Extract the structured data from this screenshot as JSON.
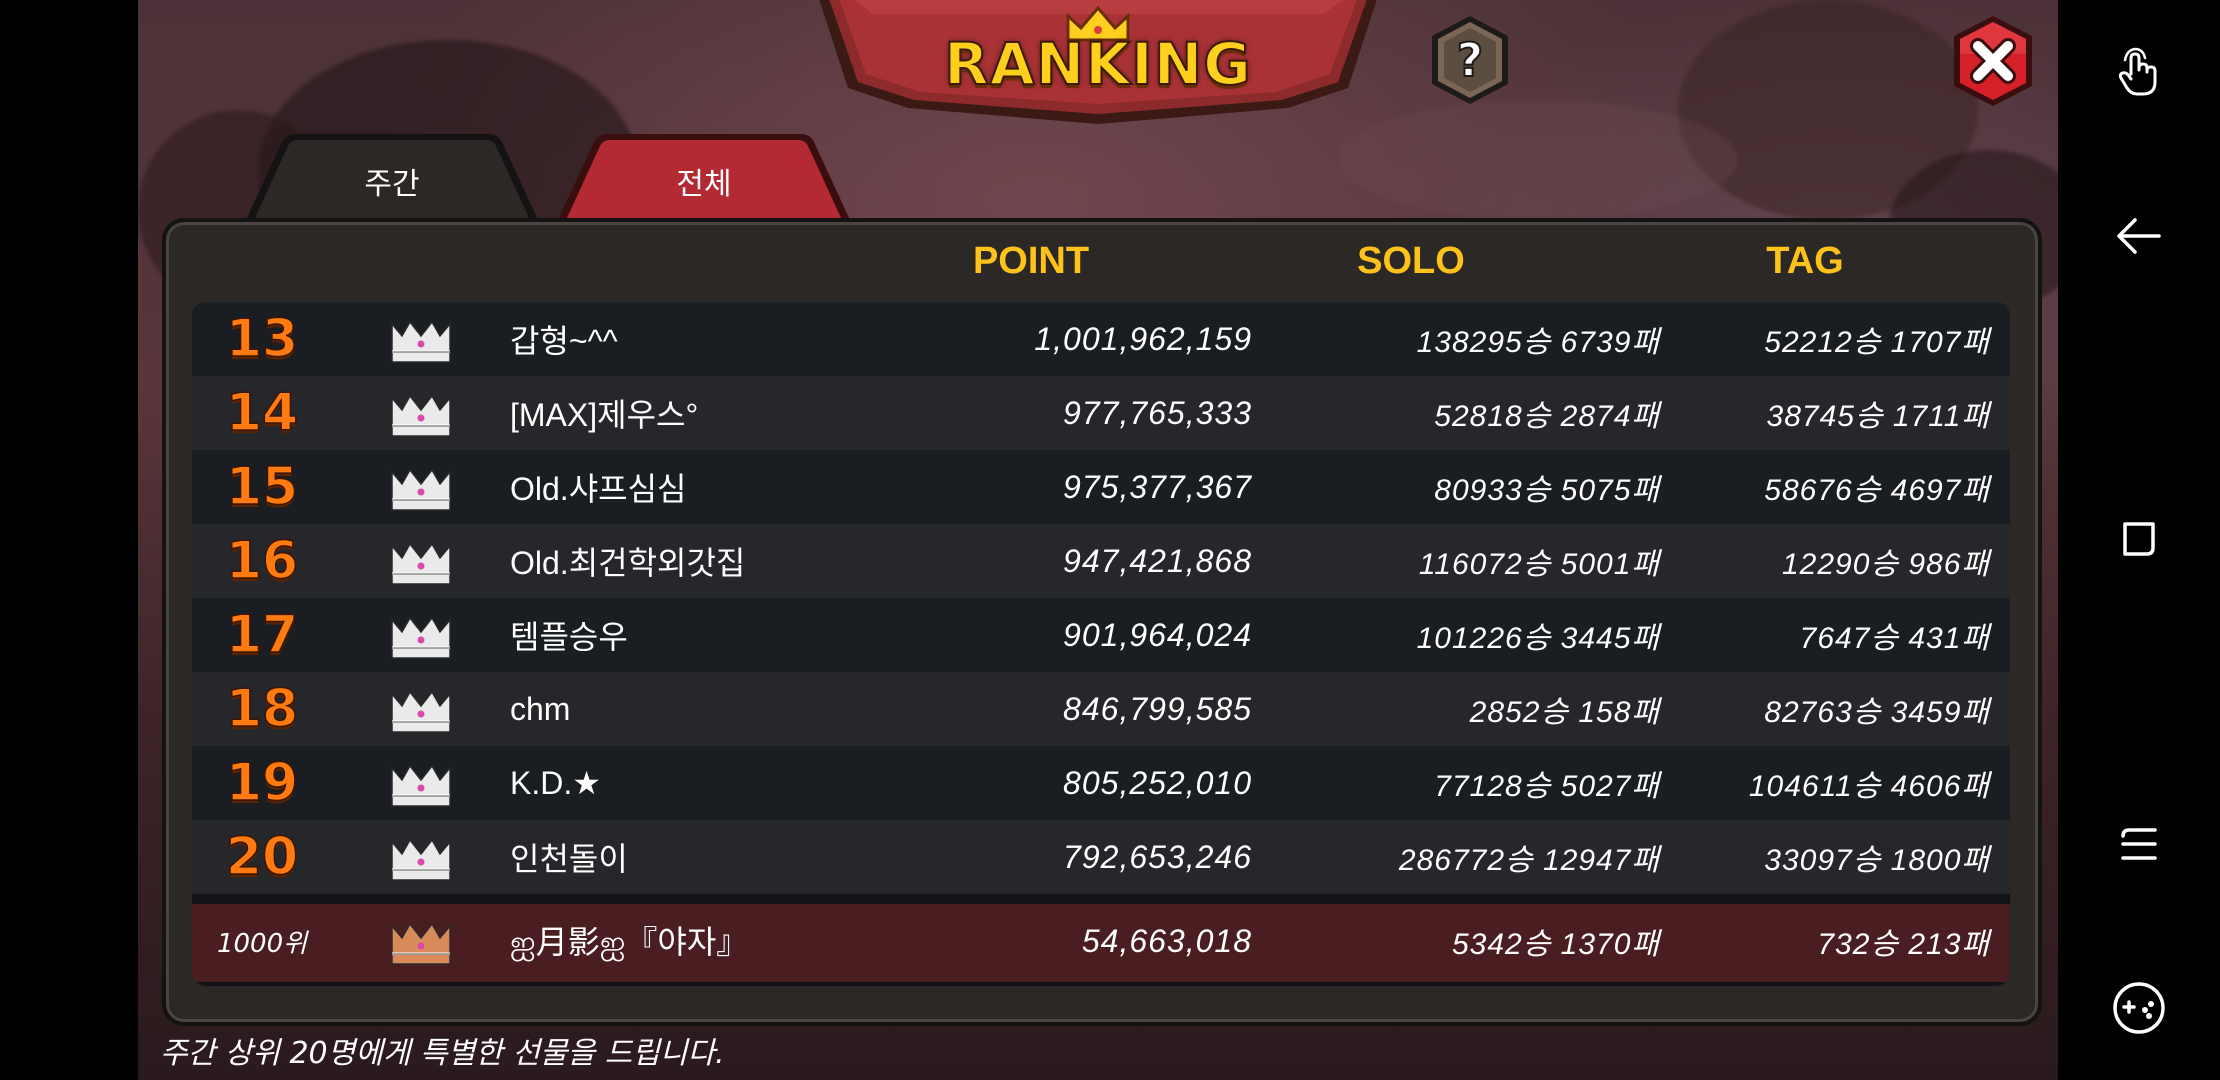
{
  "title": "RANKING",
  "tabs": [
    {
      "label": "주간",
      "active": true
    },
    {
      "label": "전체",
      "active": false
    }
  ],
  "columns": {
    "point": "POINT",
    "solo": "SOLO",
    "tag": "TAG"
  },
  "rows": [
    {
      "rank": "13",
      "name": "갑형~^^",
      "point": "1,001,962,159",
      "solo": "138295승 6739패",
      "tag": "52212승 1707패"
    },
    {
      "rank": "14",
      "name": "[MAX]제우스°",
      "point": "977,765,333",
      "solo": "52818승 2874패",
      "tag": "38745승 1711패"
    },
    {
      "rank": "15",
      "name": "Old.샤프심심",
      "point": "975,377,367",
      "solo": "80933승 5075패",
      "tag": "58676승 4697패"
    },
    {
      "rank": "16",
      "name": "Old.최건학외갓집",
      "point": "947,421,868",
      "solo": "116072승 5001패",
      "tag": "12290승 986패"
    },
    {
      "rank": "17",
      "name": "템플승우",
      "point": "901,964,024",
      "solo": "101226승 3445패",
      "tag": "7647승 431패"
    },
    {
      "rank": "18",
      "name": "chm",
      "point": "846,799,585",
      "solo": "2852승 158패",
      "tag": "82763승 3459패"
    },
    {
      "rank": "19",
      "name": "K.D.★",
      "point": "805,252,010",
      "solo": "77128승 5027패",
      "tag": "104611승 4606패"
    },
    {
      "rank": "20",
      "name": "인천돌이",
      "point": "792,653,246",
      "solo": "286772승 12947패",
      "tag": "33097승 1800패"
    }
  ],
  "my_row": {
    "rank": "1000위",
    "name": "ஐ月影ஐ『야자』",
    "point": "54,663,018",
    "solo": "5342승 1370패",
    "tag": "732승 213패"
  },
  "footer": "주간 상위 20명에게 특별한 선물을 드립니다.",
  "colors": {
    "accent": "#ffc21a",
    "rank": "#ff7a10",
    "close": "#d5202a",
    "tab_active": "#2b2826",
    "tab_inactive": "#b32a32"
  }
}
